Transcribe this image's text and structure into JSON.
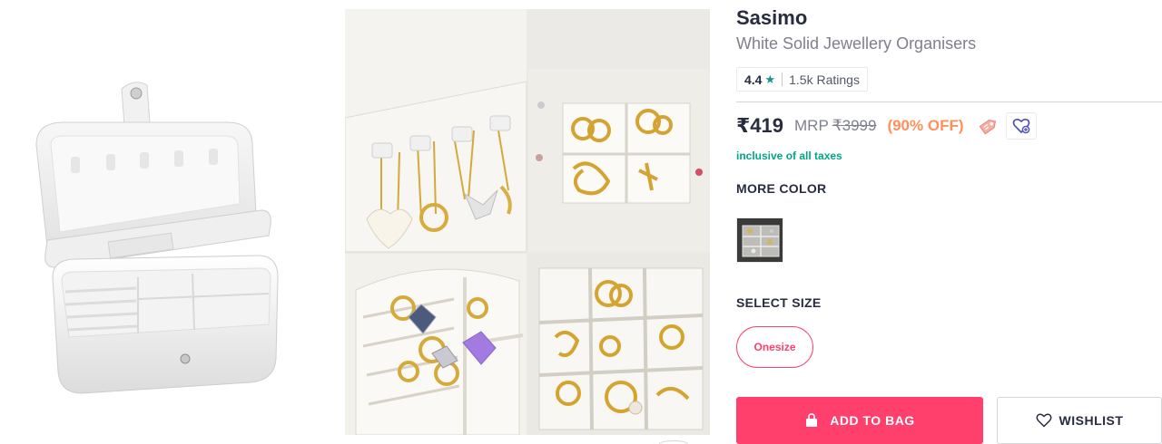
{
  "product": {
    "brand": "Sasimo",
    "name": "White Solid Jewellery Organisers"
  },
  "rating": {
    "value": "4.4",
    "star": "★",
    "count": "1.5k Ratings"
  },
  "price": {
    "selling": "₹419",
    "mrp_label": "MRP",
    "mrp": "₹3999",
    "discount": "(90% OFF)",
    "tax_note": "inclusive of all taxes"
  },
  "colors": {
    "heading": "MORE COLOR"
  },
  "sizes": {
    "heading": "SELECT SIZE",
    "options": [
      "Onesize"
    ]
  },
  "actions": {
    "add_to_bag": "ADD TO BAG",
    "wishlist": "WISHLIST"
  },
  "icons": {
    "rating": "star-icon",
    "offer": "price-tag-icon",
    "wishlist_small": "heart-plus-icon",
    "bag": "shopping-bag-icon",
    "wishlist": "heart-outline-icon"
  },
  "theme": {
    "accent": "#ff3f6c",
    "discount": "#ff905a",
    "success": "#03a685",
    "rating_star": "#14958f"
  }
}
